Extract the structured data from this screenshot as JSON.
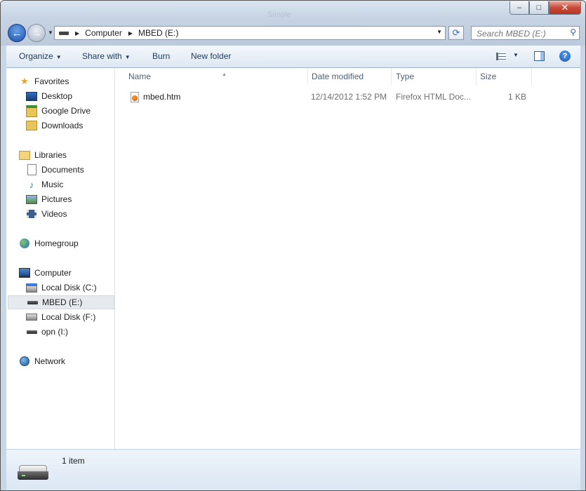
{
  "window": {
    "background_hint": "Simple"
  },
  "caption_buttons": {
    "minimize": "–",
    "maximize": "□",
    "close": "✕"
  },
  "address_bar": {
    "crumbs": [
      "Computer",
      "MBED (E:)"
    ]
  },
  "search": {
    "placeholder": "Search MBED (E:)"
  },
  "toolbar": {
    "organize": "Organize",
    "share_with": "Share with",
    "burn": "Burn",
    "new_folder": "New folder"
  },
  "nav": {
    "favorites": {
      "label": "Favorites",
      "items": [
        "Desktop",
        "Google Drive",
        "Downloads"
      ]
    },
    "libraries": {
      "label": "Libraries",
      "items": [
        "Documents",
        "Music",
        "Pictures",
        "Videos"
      ]
    },
    "homegroup": {
      "label": "Homegroup"
    },
    "computer": {
      "label": "Computer",
      "items": [
        "Local Disk (C:)",
        "MBED (E:)",
        "Local Disk (F:)",
        "opn (I:)"
      ]
    },
    "network": {
      "label": "Network"
    }
  },
  "columns": {
    "name": "Name",
    "date_modified": "Date modified",
    "type": "Type",
    "size": "Size"
  },
  "files": [
    {
      "name": "mbed.htm",
      "date_modified": "12/14/2012 1:52 PM",
      "type": "Firefox HTML Doc...",
      "size": "1 KB"
    }
  ],
  "details": {
    "item_count": "1 item"
  },
  "colors": {
    "accent": "#1e395b",
    "selection": "#e6e9ee",
    "frame": "#c9d6e5"
  }
}
